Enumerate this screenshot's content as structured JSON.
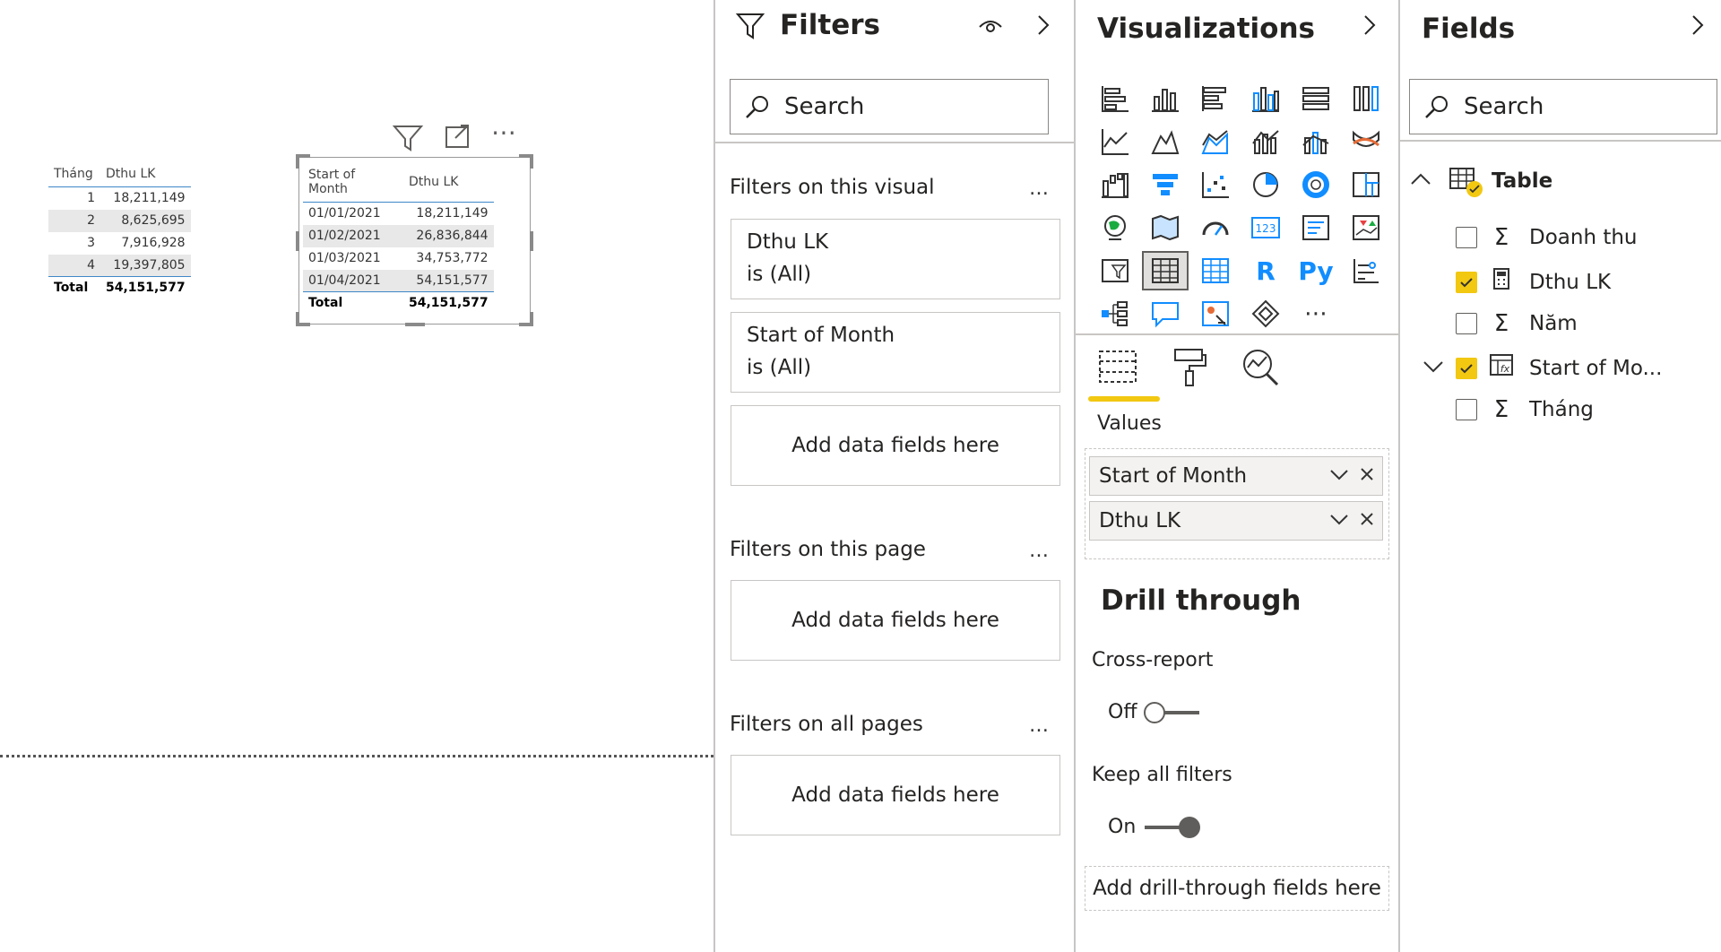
{
  "table1": {
    "headers": [
      "Tháng",
      "Dthu LK"
    ],
    "rows": [
      [
        "1",
        "18,211,149"
      ],
      [
        "2",
        "8,625,695"
      ],
      [
        "3",
        "7,916,928"
      ],
      [
        "4",
        "19,397,805"
      ]
    ],
    "total": [
      "Total",
      "54,151,577"
    ]
  },
  "table2": {
    "headers": [
      "Start of Month",
      "Dthu LK"
    ],
    "rows": [
      [
        "01/01/2021",
        "18,211,149"
      ],
      [
        "01/02/2021",
        "26,836,844"
      ],
      [
        "01/03/2021",
        "34,753,772"
      ],
      [
        "01/04/2021",
        "54,151,577"
      ]
    ],
    "total": [
      "Total",
      "54,151,577"
    ]
  },
  "visual_toolbar": {
    "more": "⋯"
  },
  "filters": {
    "title": "Filters",
    "search_placeholder": "Search",
    "visual_section": "Filters on this visual",
    "page_section": "Filters on this page",
    "all_section": "Filters on all pages",
    "more": "…",
    "cards": [
      {
        "field": "Dthu LK",
        "state": "is (All)"
      },
      {
        "field": "Start of Month",
        "state": "is (All)"
      }
    ],
    "add_label": "Add data fields here"
  },
  "viz": {
    "title": "Visualizations",
    "more_visuals": "⋯",
    "r_visual": "R",
    "py_visual": "Py",
    "values_label": "Values",
    "values": [
      "Start of Month",
      "Dthu LK"
    ],
    "drill_title": "Drill through",
    "cross_report": "Cross-report",
    "cross_state": "Off",
    "keep_filters": "Keep all filters",
    "keep_state": "On",
    "drill_add": "Add drill-through fields here"
  },
  "fields": {
    "title": "Fields",
    "search_placeholder": "Search",
    "table_name": "Table",
    "items": [
      {
        "name": "Doanh thu",
        "checked": false,
        "icon": "sigma"
      },
      {
        "name": "Dthu LK",
        "checked": true,
        "icon": "calculator"
      },
      {
        "name": "Năm",
        "checked": false,
        "icon": "sigma"
      },
      {
        "name": "Start of Mo...",
        "checked": true,
        "icon": "date-hierarchy"
      },
      {
        "name": "Tháng",
        "checked": false,
        "icon": "sigma"
      }
    ]
  },
  "colors": {
    "accent": "#f2c811",
    "header_line": "#3f87c8",
    "viz_blue": "#118dff"
  }
}
